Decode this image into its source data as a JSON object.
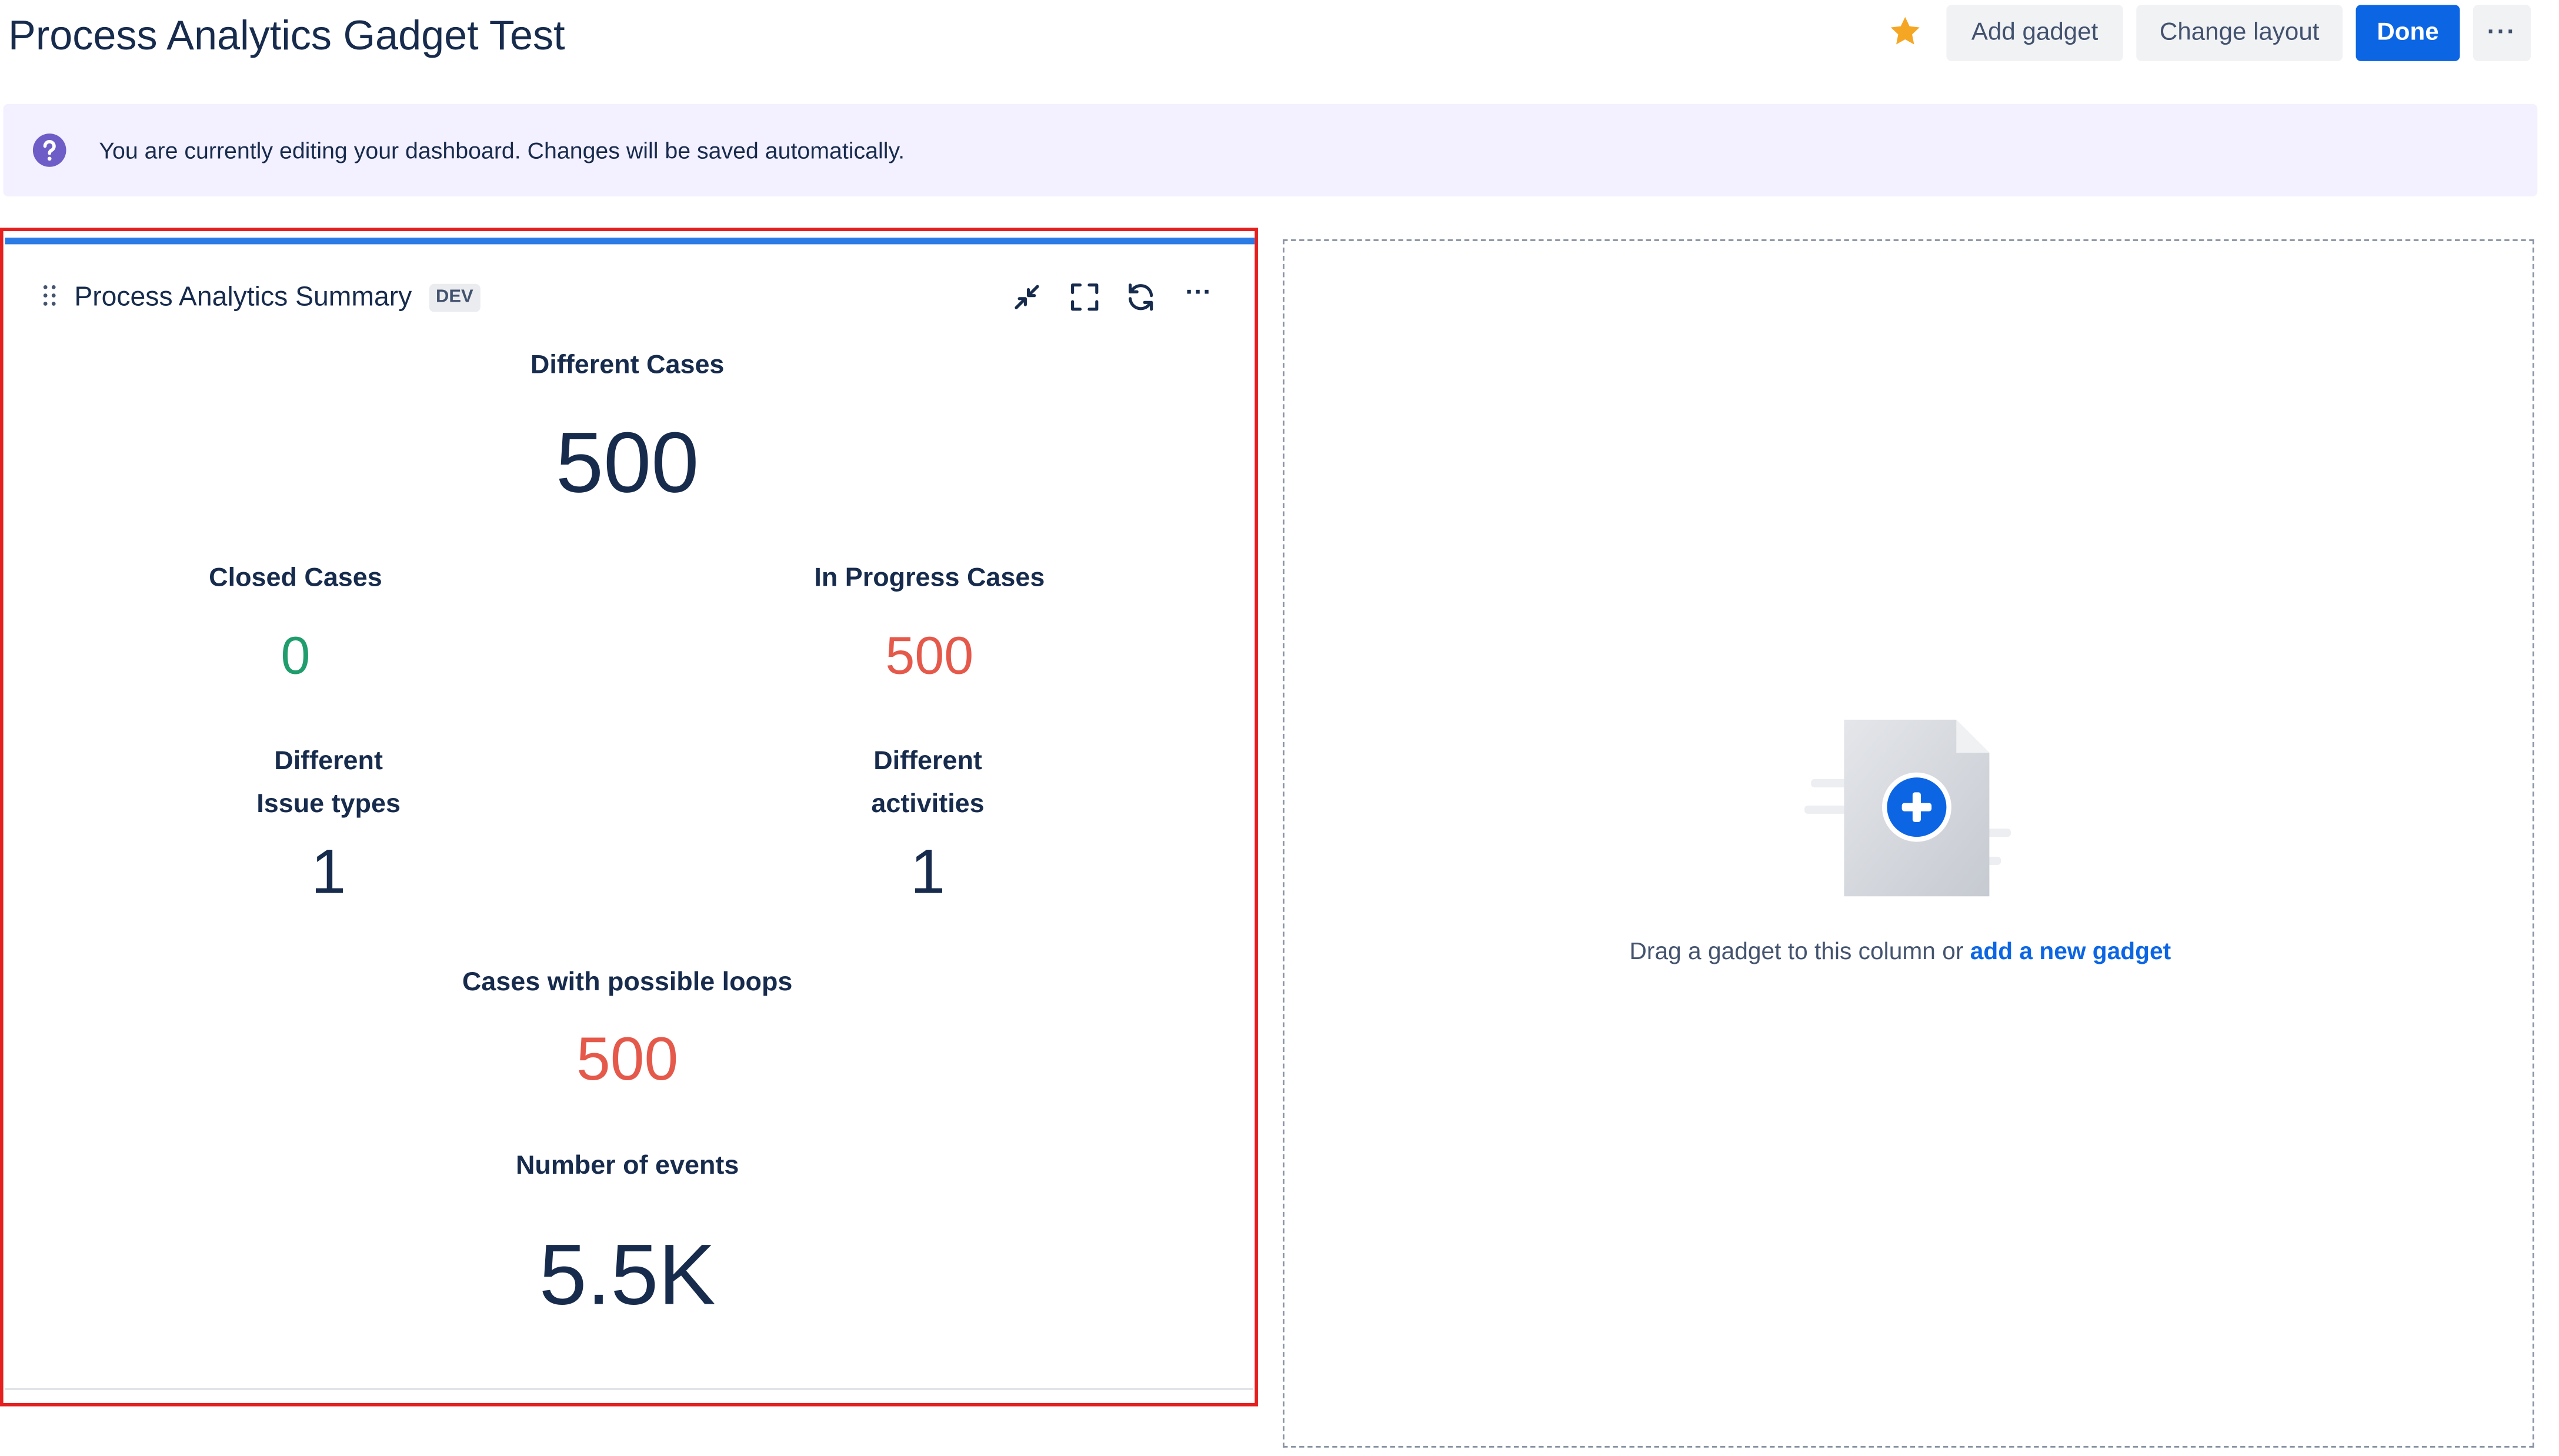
{
  "header": {
    "title": "Process Analytics Gadget Test",
    "add_gadget": "Add gadget",
    "change_layout": "Change layout",
    "done": "Done",
    "more": "···"
  },
  "banner": {
    "text": "You are currently editing your dashboard. Changes will be saved automatically."
  },
  "gadget": {
    "title": "Process Analytics Summary",
    "badge": "DEV",
    "more": "···",
    "metrics": {
      "different_cases": {
        "label": "Different Cases",
        "value": "500"
      },
      "closed_cases": {
        "label": "Closed Cases",
        "value": "0"
      },
      "in_progress_cases": {
        "label": "In Progress Cases",
        "value": "500"
      },
      "issue_types": {
        "label_line1": "Different",
        "label_line2": "Issue types",
        "value": "1"
      },
      "activities": {
        "label_line1": "Different",
        "label_line2": "activities",
        "value": "1"
      },
      "loops": {
        "label": "Cases with possible loops",
        "value": "500"
      },
      "events": {
        "label": "Number of events",
        "value": "5.5K"
      }
    }
  },
  "empty_column": {
    "text": "Drag a gadget to this column or ",
    "link": "add a new gadget"
  },
  "colors": {
    "primary": "#0c66e4",
    "highlight_border": "#e5201f",
    "success": "#1f9d6c",
    "danger": "#e5594b",
    "star": "#f5a623"
  },
  "icons": [
    "star-icon",
    "question-icon",
    "drag-handle-icon",
    "minimize-icon",
    "fullscreen-icon",
    "refresh-icon",
    "more-icon",
    "add-gadget-illustration"
  ]
}
